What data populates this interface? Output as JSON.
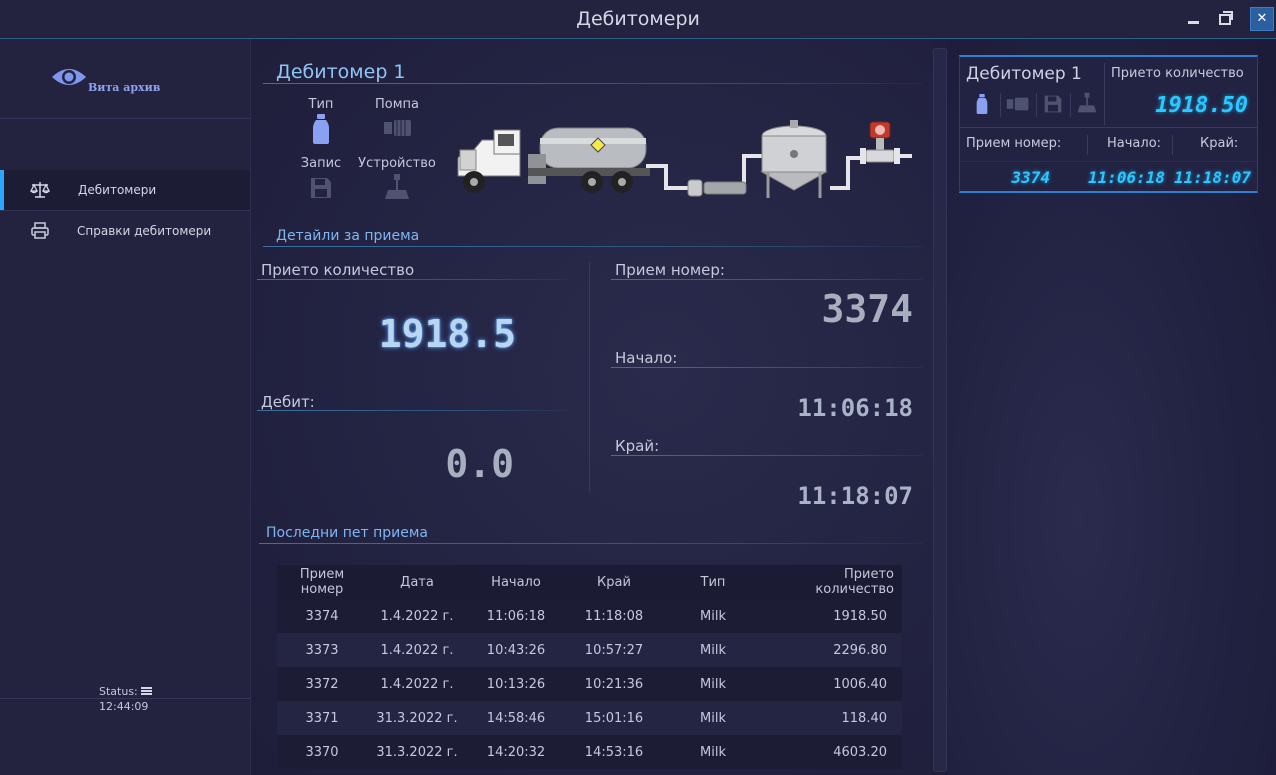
{
  "window": {
    "title": "Дебитомери"
  },
  "sidebar": {
    "logo_text": "Вита архив",
    "items": [
      {
        "label": "Дебитомери",
        "icon": "scale-icon",
        "active": true
      },
      {
        "label": "Справки дебитомери",
        "icon": "printer-icon",
        "active": false
      }
    ],
    "status_label": "Status:",
    "status_time": "12:44:09"
  },
  "main": {
    "device_title": "Дебитомер 1",
    "icons": {
      "type_label": "Тип",
      "pump_label": "Помпа",
      "record_label": "Запис",
      "device_label": "Устройство"
    },
    "details_title": "Детайли за приема",
    "received_qty_label": "Прието количество",
    "received_qty_value": "1918.5",
    "flow_label": "Дебит:",
    "flow_value": "0.0",
    "receipt_no_label": "Прием номер:",
    "receipt_no_value": "3374",
    "start_label": "Начало:",
    "start_value": "11:06:18",
    "end_label": "Край:",
    "end_value": "11:18:07",
    "last_five_title": "Последни пет приема",
    "table": {
      "headers": [
        "Прием номер",
        "Дата",
        "Начало",
        "Край",
        "Тип",
        "Прието количество"
      ],
      "rows": [
        [
          "3374",
          "1.4.2022 г.",
          "11:06:18",
          "11:18:08",
          "Milk",
          "1918.50"
        ],
        [
          "3373",
          "1.4.2022 г.",
          "10:43:26",
          "10:57:27",
          "Milk",
          "2296.80"
        ],
        [
          "3372",
          "1.4.2022 г.",
          "10:13:26",
          "10:21:36",
          "Milk",
          "1006.40"
        ],
        [
          "3371",
          "31.3.2022 г.",
          "14:58:46",
          "15:01:16",
          "Milk",
          "118.40"
        ],
        [
          "3370",
          "31.3.2022 г.",
          "14:20:32",
          "14:53:16",
          "Milk",
          "4603.20"
        ]
      ]
    }
  },
  "card": {
    "title": "Дебитомер 1",
    "qty_label": "Прието количество",
    "qty_value": "1918.50",
    "receipt_label": "Прием номер:",
    "start_label": "Начало:",
    "end_label": "Край:",
    "receipt_value": "3374",
    "start_value": "11:06:18",
    "end_value": "11:18:07"
  },
  "colors": {
    "background": "#1f1f3b",
    "accent": "#2aa8ff",
    "section_title": "#7fb6f0",
    "segment_display": "#29c8ff"
  }
}
